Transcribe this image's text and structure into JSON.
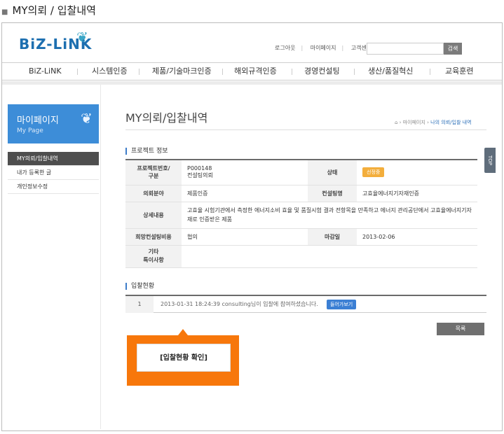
{
  "page_title": "MY의뢰 / 입찰내역",
  "header": {
    "logo": "BiZ-LiNK",
    "util_links": [
      "로그아웃",
      "마이페이지",
      "고객센터"
    ],
    "search_button": "검색"
  },
  "gnb": [
    "BiZ-LiNK",
    "시스템인증",
    "제품/기술마크인증",
    "해외규격인증",
    "경영컨설팅",
    "생산/품질혁신",
    "교육훈련"
  ],
  "lnb": {
    "title": "마이페이지",
    "subtitle": "My Page",
    "items": [
      "MY의뢰/입찰내역",
      "내가 등록한 글",
      "개인정보수정"
    ]
  },
  "content": {
    "heading": "MY의뢰/입찰내역",
    "breadcrumb": [
      "마이페이지",
      "나의 의뢰/입찰 내역"
    ],
    "section1": "프로젝트 정보",
    "project": {
      "no_label": "프로젝트번호/\n구분",
      "no_value": "P000148",
      "type_value": "컨설팅의뢰",
      "status_label": "상태",
      "status_value": "선정중",
      "field_label": "의뢰분야",
      "field_value": "제품인증",
      "consult_label": "컨설팅명",
      "consult_value": "고효율에너지기자재인증",
      "detail_label": "상세내용",
      "detail_value": "고효율 시험기관에서 측정한 에너지소비 효율 및 품질시험 결과 전항목을 만족하고 에너지 관리공단에서 고효율에너지기자재로 인증받은 제품",
      "cost_label": "희망컨설팅비용",
      "cost_value": "협의",
      "deadline_label": "마감일",
      "deadline_value": "2013-02-06",
      "etc_label": "기타\n특이사항",
      "etc_value": ""
    },
    "section2": "입찰현황",
    "bid": {
      "num": "1",
      "text": "2013-01-31 18:24:39   consulting님이 입찰에 참여하셨습니다.",
      "button": "들어가보기"
    },
    "list_button": "목록",
    "callout": "[입찰현황 확인]",
    "top_tab": "TOP"
  },
  "colors": {
    "accent": "#3d8dd8",
    "callout": "#f7770b",
    "status": "#f3ae3c"
  }
}
